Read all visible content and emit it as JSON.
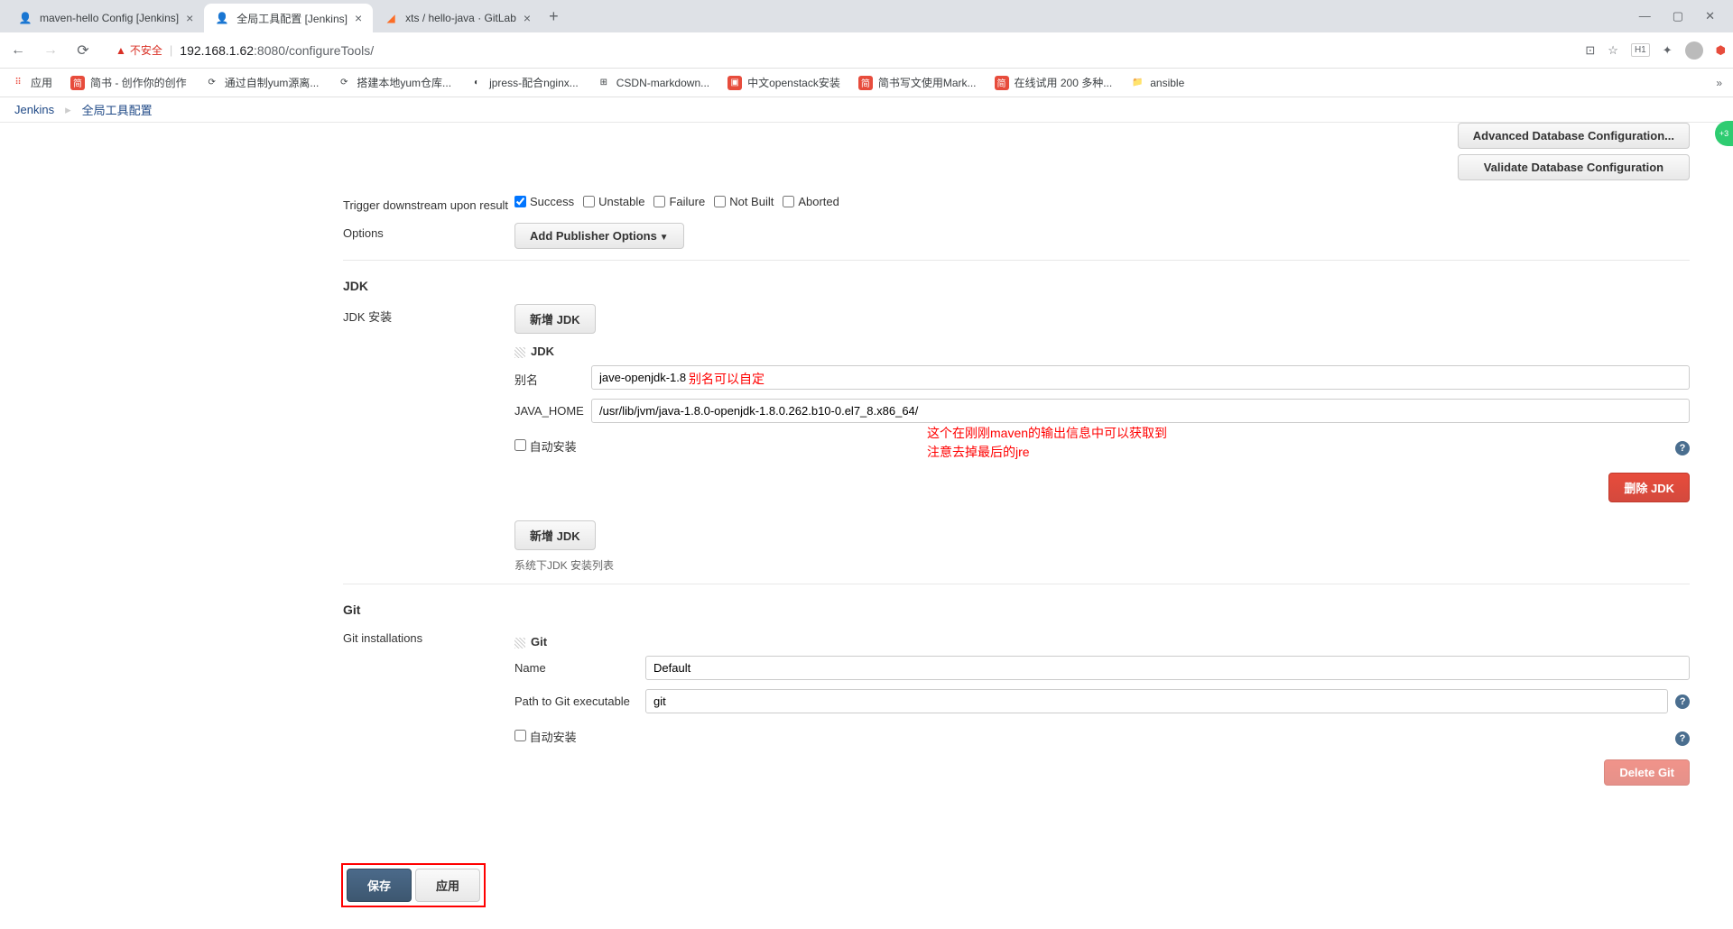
{
  "browser": {
    "tabs": [
      {
        "title": "maven-hello Config [Jenkins]",
        "active": false
      },
      {
        "title": "全局工具配置 [Jenkins]",
        "active": true
      },
      {
        "title": "xts / hello-java · GitLab",
        "active": false
      }
    ],
    "url_warning": "不安全",
    "url_host": "192.168.1.62",
    "url_port": ":8080",
    "url_path": "/configureTools/",
    "ext_h1": "H1"
  },
  "bookmarks": {
    "apps": "应用",
    "items": [
      {
        "label": "简书 - 创作你的创作",
        "icon": "简",
        "color": "#e74c3c"
      },
      {
        "label": "通过自制yum源离...",
        "icon": "⟳",
        "color": "#888"
      },
      {
        "label": "搭建本地yum仓库...",
        "icon": "⟳",
        "color": "#888"
      },
      {
        "label": "jpress-配合nginx...",
        "icon": "◐",
        "color": "#888"
      },
      {
        "label": "CSDN-markdown...",
        "icon": "⊞",
        "color": "#888"
      },
      {
        "label": "中文openstack安装",
        "icon": "▣",
        "color": "#e74c3c"
      },
      {
        "label": "简书写文使用Mark...",
        "icon": "简",
        "color": "#e74c3c"
      },
      {
        "label": "在线试用 200 多种...",
        "icon": "简",
        "color": "#e74c3c"
      },
      {
        "label": "ansible",
        "icon": "📁",
        "color": "#f5c518"
      }
    ]
  },
  "breadcrumb": {
    "root": "Jenkins",
    "current": "全局工具配置"
  },
  "buttons": {
    "adv_db": "Advanced Database Configuration...",
    "validate_db": "Validate Database Configuration",
    "add_publisher": "Add Publisher Options",
    "add_jdk": "新增 JDK",
    "delete_jdk": "删除 JDK",
    "delete_git": "Delete Git",
    "save": "保存",
    "apply": "应用"
  },
  "trigger": {
    "label": "Trigger downstream upon result",
    "opts": [
      "Success",
      "Unstable",
      "Failure",
      "Not Built",
      "Aborted"
    ]
  },
  "options_label": "Options",
  "jdk": {
    "heading": "JDK",
    "install_label": "JDK 安装",
    "subheading": "JDK",
    "alias_label": "别名",
    "alias_value": "jave-openjdk-1.8",
    "alias_note": "别名可以自定",
    "home_label": "JAVA_HOME",
    "home_value": "/usr/lib/jvm/java-1.8.0-openjdk-1.8.0.262.b10-0.el7_8.x86_64/",
    "home_note1": "这个在刚刚maven的输出信息中可以获取到",
    "home_note2": "注意去掉最后的jre",
    "auto_install": "自动安装",
    "caption": "系统下JDK 安装列表"
  },
  "git": {
    "heading": "Git",
    "installations_label": "Git installations",
    "subheading": "Git",
    "name_label": "Name",
    "name_value": "Default",
    "path_label": "Path to Git executable",
    "path_value": "git",
    "auto_install": "自动安装"
  },
  "badge": "+3"
}
